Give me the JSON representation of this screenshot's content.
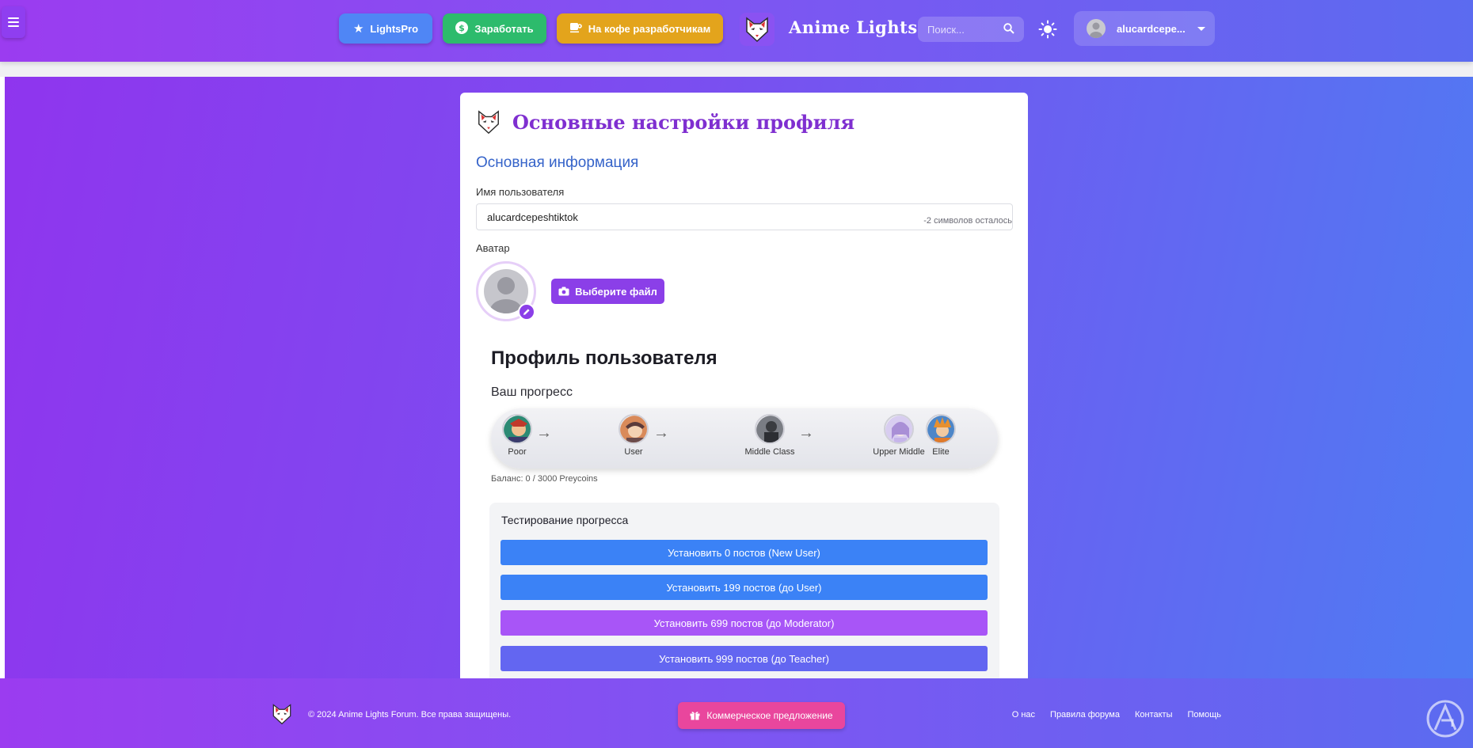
{
  "header": {
    "menu_icon": "hamburger-menu-icon",
    "buttons": [
      {
        "label": "LightsPro",
        "icon": "star-icon",
        "color": "#4f86f5"
      },
      {
        "label": "Заработать",
        "icon": "dollar-icon",
        "color": "#2dbb6c"
      },
      {
        "label": "На кофе разработчикам",
        "icon": "coffee-icon",
        "color": "#e3a41c"
      }
    ],
    "brand_name": "Anime Lights",
    "search": {
      "placeholder": "Поиск...",
      "value": ""
    },
    "theme_icon": "sun-icon",
    "user": {
      "name": "alucardcepe..."
    }
  },
  "card": {
    "title": "Основные настройки профиля",
    "section_title": "Основная информация",
    "username": {
      "label": "Имя пользователя",
      "value": "alucardcepeshtiktok",
      "chars_left": "-2 символов осталось"
    },
    "avatar": {
      "label": "Аватар",
      "choose_file": "Выберите файл"
    },
    "profile_title": "Профиль пользователя",
    "progress": {
      "title": "Ваш прогресс",
      "ranks": [
        {
          "label": "Poor",
          "color": "#2c8a74"
        },
        {
          "label": "User",
          "color": "#d98a5a"
        },
        {
          "label": "Middle Class",
          "color": "#55585e"
        },
        {
          "label": "Upper Middle",
          "color": "#b9a6e0"
        },
        {
          "label": "Elite",
          "color": "#e58b3a"
        }
      ],
      "balance": "Баланс: 0 / 3000 Preycoins"
    },
    "testing": {
      "title": "Тестирование прогресса",
      "buttons": [
        {
          "label": "Установить 0 постов (New User)",
          "color": "#3b82f6"
        },
        {
          "label": "Установить 199 постов (до User)",
          "color": "#3b82f6"
        },
        {
          "label": "Установить 699 постов (до Moderator)",
          "color": "#a855f7"
        },
        {
          "label": "Установить 999 постов (до Teacher)",
          "color": "#6366f1"
        }
      ]
    }
  },
  "footer": {
    "copyright": "© 2024 Anime Lights Forum. Все права защищены.",
    "offer_button": "Коммерческое предложение",
    "links": [
      "О нас",
      "Правила форума",
      "Контакты",
      "Помощь"
    ]
  }
}
